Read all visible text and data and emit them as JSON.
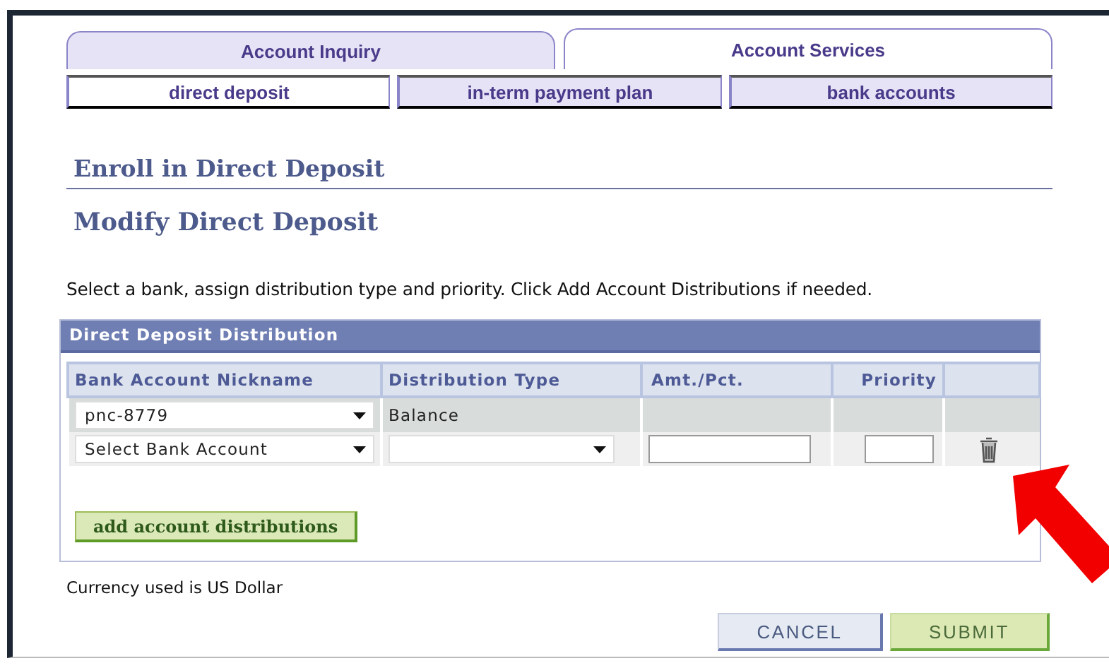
{
  "tabs": [
    {
      "label": "Account Inquiry",
      "selected": false
    },
    {
      "label": "Account Services",
      "selected": true
    }
  ],
  "subtabs": [
    {
      "label": "direct deposit",
      "selected": true
    },
    {
      "label": "in-term payment plan",
      "selected": false
    },
    {
      "label": "bank accounts",
      "selected": false
    }
  ],
  "section_title": "Enroll in Direct Deposit",
  "page_title": "Modify Direct Deposit",
  "instructions": "Select a bank, assign distribution type and priority. Click Add Account Distributions if needed.",
  "distribution": {
    "title": "Direct Deposit Distribution",
    "columns": [
      "Bank Account Nickname",
      "Distribution Type",
      "Amt./Pct.",
      "Priority"
    ],
    "rows": [
      {
        "kind": "fixed",
        "bank_account": "pnc-8779",
        "distribution_type": "Balance"
      },
      {
        "kind": "editable",
        "bank_account": "Select Bank Account"
      }
    ]
  },
  "add_button": "add account distributions",
  "currency_note": "Currency used is US Dollar",
  "buttons": [
    {
      "label": "CANCEL",
      "kind": "secondary"
    },
    {
      "label": "SUBMIT",
      "kind": "primary"
    }
  ]
}
